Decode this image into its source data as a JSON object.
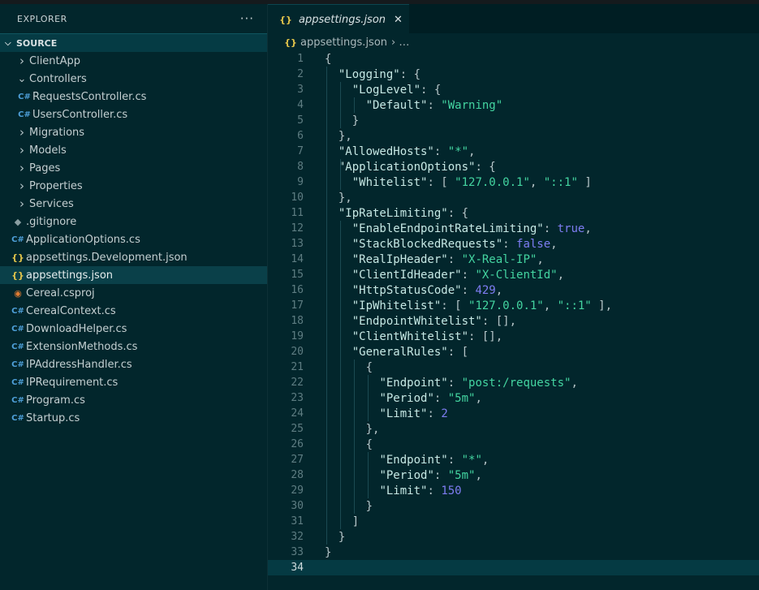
{
  "sidebar": {
    "title": "EXPLORER",
    "more_label": "···",
    "section": "SOURCE",
    "items": [
      {
        "label": "ClientApp",
        "type": "folder",
        "expanded": false,
        "indent": 1
      },
      {
        "label": "Controllers",
        "type": "folder",
        "expanded": true,
        "indent": 1
      },
      {
        "label": "RequestsController.cs",
        "type": "cs",
        "indent": 2
      },
      {
        "label": "UsersController.cs",
        "type": "cs",
        "indent": 2
      },
      {
        "label": "Migrations",
        "type": "folder",
        "expanded": false,
        "indent": 1
      },
      {
        "label": "Models",
        "type": "folder",
        "expanded": false,
        "indent": 1
      },
      {
        "label": "Pages",
        "type": "folder",
        "expanded": false,
        "indent": 1
      },
      {
        "label": "Properties",
        "type": "folder",
        "expanded": false,
        "indent": 1
      },
      {
        "label": "Services",
        "type": "folder",
        "expanded": false,
        "indent": 1
      },
      {
        "label": ".gitignore",
        "type": "git",
        "indent": 1
      },
      {
        "label": "ApplicationOptions.cs",
        "type": "cs",
        "indent": 1
      },
      {
        "label": "appsettings.Development.json",
        "type": "json",
        "indent": 1
      },
      {
        "label": "appsettings.json",
        "type": "json",
        "indent": 1,
        "selected": true
      },
      {
        "label": "Cereal.csproj",
        "type": "rss",
        "indent": 1
      },
      {
        "label": "CerealContext.cs",
        "type": "cs",
        "indent": 1
      },
      {
        "label": "DownloadHelper.cs",
        "type": "cs",
        "indent": 1
      },
      {
        "label": "ExtensionMethods.cs",
        "type": "cs",
        "indent": 1
      },
      {
        "label": "IPAddressHandler.cs",
        "type": "cs",
        "indent": 1
      },
      {
        "label": "IPRequirement.cs",
        "type": "cs",
        "indent": 1
      },
      {
        "label": "Program.cs",
        "type": "cs",
        "indent": 1
      },
      {
        "label": "Startup.cs",
        "type": "cs",
        "indent": 1
      }
    ]
  },
  "tab": {
    "title": "appsettings.json",
    "close": "✕"
  },
  "breadcrumb": {
    "file": "appsettings.json",
    "rest": "› …"
  },
  "icons": {
    "folder_closed": "chevron-right-icon",
    "folder_open": "chevron-down-icon",
    "cs": "csharp-file-icon",
    "json": "json-file-icon",
    "git": "git-file-icon",
    "rss": "project-file-icon"
  },
  "colors": {
    "key": "#c7e8e4",
    "string": "#44d5a1",
    "number": "#7e7df2",
    "background": "#02262c"
  },
  "code": {
    "current_line": 34,
    "lines": [
      [
        [
          "{",
          "p"
        ]
      ],
      [
        [
          "  ",
          ""
        ],
        [
          "\"Logging\"",
          "k"
        ],
        [
          ": {",
          "p"
        ]
      ],
      [
        [
          "    ",
          ""
        ],
        [
          "\"LogLevel\"",
          "k"
        ],
        [
          ": {",
          "p"
        ]
      ],
      [
        [
          "      ",
          ""
        ],
        [
          "\"Default\"",
          "k"
        ],
        [
          ": ",
          "p"
        ],
        [
          "\"Warning\"",
          "s"
        ]
      ],
      [
        [
          "    }",
          "p"
        ]
      ],
      [
        [
          "  },",
          "p"
        ]
      ],
      [
        [
          "  ",
          ""
        ],
        [
          "\"AllowedHosts\"",
          "k"
        ],
        [
          ": ",
          "p"
        ],
        [
          "\"*\"",
          "s"
        ],
        [
          ",",
          "p"
        ]
      ],
      [
        [
          "  ",
          ""
        ],
        [
          "\"ApplicationOptions\"",
          "k"
        ],
        [
          ": {",
          "p"
        ]
      ],
      [
        [
          "    ",
          ""
        ],
        [
          "\"Whitelist\"",
          "k"
        ],
        [
          ": [ ",
          "p"
        ],
        [
          "\"127.0.0.1\"",
          "s"
        ],
        [
          ", ",
          "p"
        ],
        [
          "\"::1\"",
          "s"
        ],
        [
          " ]",
          "p"
        ]
      ],
      [
        [
          "  },",
          "p"
        ]
      ],
      [
        [
          "  ",
          ""
        ],
        [
          "\"IpRateLimiting\"",
          "k"
        ],
        [
          ": {",
          "p"
        ]
      ],
      [
        [
          "    ",
          ""
        ],
        [
          "\"EnableEndpointRateLimiting\"",
          "k"
        ],
        [
          ": ",
          "p"
        ],
        [
          "true",
          "b"
        ],
        [
          ",",
          "p"
        ]
      ],
      [
        [
          "    ",
          ""
        ],
        [
          "\"StackBlockedRequests\"",
          "k"
        ],
        [
          ": ",
          "p"
        ],
        [
          "false",
          "b"
        ],
        [
          ",",
          "p"
        ]
      ],
      [
        [
          "    ",
          ""
        ],
        [
          "\"RealIpHeader\"",
          "k"
        ],
        [
          ": ",
          "p"
        ],
        [
          "\"X-Real-IP\"",
          "s"
        ],
        [
          ",",
          "p"
        ]
      ],
      [
        [
          "    ",
          ""
        ],
        [
          "\"ClientIdHeader\"",
          "k"
        ],
        [
          ": ",
          "p"
        ],
        [
          "\"X-ClientId\"",
          "s"
        ],
        [
          ",",
          "p"
        ]
      ],
      [
        [
          "    ",
          ""
        ],
        [
          "\"HttpStatusCode\"",
          "k"
        ],
        [
          ": ",
          "p"
        ],
        [
          "429",
          "n"
        ],
        [
          ",",
          "p"
        ]
      ],
      [
        [
          "    ",
          ""
        ],
        [
          "\"IpWhitelist\"",
          "k"
        ],
        [
          ": [ ",
          "p"
        ],
        [
          "\"127.0.0.1\"",
          "s"
        ],
        [
          ", ",
          "p"
        ],
        [
          "\"::1\"",
          "s"
        ],
        [
          " ],",
          "p"
        ]
      ],
      [
        [
          "    ",
          ""
        ],
        [
          "\"EndpointWhitelist\"",
          "k"
        ],
        [
          ": [],",
          "p"
        ]
      ],
      [
        [
          "    ",
          ""
        ],
        [
          "\"ClientWhitelist\"",
          "k"
        ],
        [
          ": [],",
          "p"
        ]
      ],
      [
        [
          "    ",
          ""
        ],
        [
          "\"GeneralRules\"",
          "k"
        ],
        [
          ": [",
          "p"
        ]
      ],
      [
        [
          "      {",
          "p"
        ]
      ],
      [
        [
          "        ",
          ""
        ],
        [
          "\"Endpoint\"",
          "k"
        ],
        [
          ": ",
          "p"
        ],
        [
          "\"post:/requests\"",
          "s"
        ],
        [
          ",",
          "p"
        ]
      ],
      [
        [
          "        ",
          ""
        ],
        [
          "\"Period\"",
          "k"
        ],
        [
          ": ",
          "p"
        ],
        [
          "\"5m\"",
          "s"
        ],
        [
          ",",
          "p"
        ]
      ],
      [
        [
          "        ",
          ""
        ],
        [
          "\"Limit\"",
          "k"
        ],
        [
          ": ",
          "p"
        ],
        [
          "2",
          "n"
        ]
      ],
      [
        [
          "      },",
          "p"
        ]
      ],
      [
        [
          "      {",
          "p"
        ]
      ],
      [
        [
          "        ",
          ""
        ],
        [
          "\"Endpoint\"",
          "k"
        ],
        [
          ": ",
          "p"
        ],
        [
          "\"*\"",
          "s"
        ],
        [
          ",",
          "p"
        ]
      ],
      [
        [
          "        ",
          ""
        ],
        [
          "\"Period\"",
          "k"
        ],
        [
          ": ",
          "p"
        ],
        [
          "\"5m\"",
          "s"
        ],
        [
          ",",
          "p"
        ]
      ],
      [
        [
          "        ",
          ""
        ],
        [
          "\"Limit\"",
          "k"
        ],
        [
          ": ",
          "p"
        ],
        [
          "150",
          "n"
        ]
      ],
      [
        [
          "      }",
          "p"
        ]
      ],
      [
        [
          "    ]",
          "p"
        ]
      ],
      [
        [
          "  }",
          "p"
        ]
      ],
      [
        [
          "}",
          "p"
        ]
      ],
      [
        [
          "",
          ""
        ]
      ]
    ]
  }
}
